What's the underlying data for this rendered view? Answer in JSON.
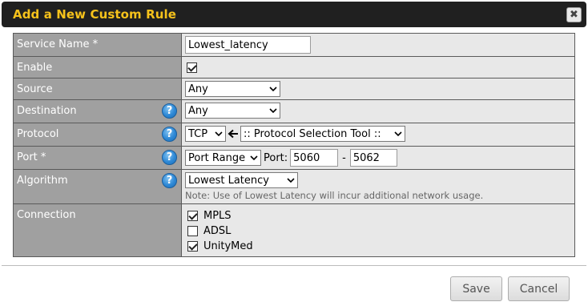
{
  "dialog": {
    "title": "Add a New Custom Rule",
    "close_label": "✖"
  },
  "form": {
    "service_name": {
      "label": "Service Name *",
      "value": "Lowest_latency"
    },
    "enable": {
      "label": "Enable",
      "checked": true
    },
    "source": {
      "label": "Source",
      "selected": "Any"
    },
    "destination": {
      "label": "Destination",
      "selected": "Any"
    },
    "protocol": {
      "label": "Protocol",
      "selected": "TCP",
      "tool_selected": ":: Protocol Selection Tool ::"
    },
    "port": {
      "label": "Port *",
      "selected": "Port Range",
      "port_label": "Port:",
      "from": "5060",
      "dash": "-",
      "to": "5062"
    },
    "algorithm": {
      "label": "Algorithm",
      "selected": "Lowest Latency",
      "note": "Note: Use of Lowest Latency will incur additional network usage."
    },
    "connection": {
      "label": "Connection",
      "items": [
        {
          "label": "MPLS",
          "checked": true
        },
        {
          "label": "ADSL",
          "checked": false
        },
        {
          "label": "UnityMed",
          "checked": true
        }
      ]
    },
    "help_glyph": "?"
  },
  "buttons": {
    "save": "Save",
    "cancel": "Cancel"
  },
  "colors": {
    "title": "#f6c21b",
    "titlebar": "#202020",
    "label_bg": "#a0a0a0",
    "value_bg": "#e8e8e8"
  }
}
